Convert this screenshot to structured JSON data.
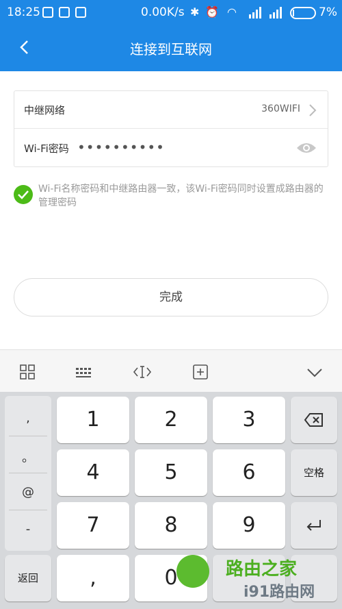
{
  "status_bar": {
    "time": "18:25",
    "speed": "0.00K/s",
    "battery_percent": "7%",
    "battery_level": 0.07
  },
  "header": {
    "title": "连接到互联网"
  },
  "form": {
    "relay_network_label": "中继网络",
    "relay_network_value": "360WIFI",
    "wifi_password_label": "Wi-Fi密码",
    "wifi_password_masked": "••••••••••"
  },
  "sync_note": "Wi-Fi名称密码和中继路由器一致，该Wi-Fi密码同时设置成路由器的管理密码",
  "done_label": "完成",
  "keyboard": {
    "symbols": [
      ",",
      "。",
      "@",
      "-"
    ],
    "keys": [
      "1",
      "2",
      "3",
      "4",
      "5",
      "6",
      "7",
      "8",
      "9",
      ",",
      "0"
    ],
    "space_label": "空格",
    "back_label": "返回"
  },
  "watermark": {
    "line1": "路由之家",
    "line2": "i91路由网"
  },
  "colors": {
    "accent": "#1e88e5",
    "check": "#4cbb17"
  }
}
